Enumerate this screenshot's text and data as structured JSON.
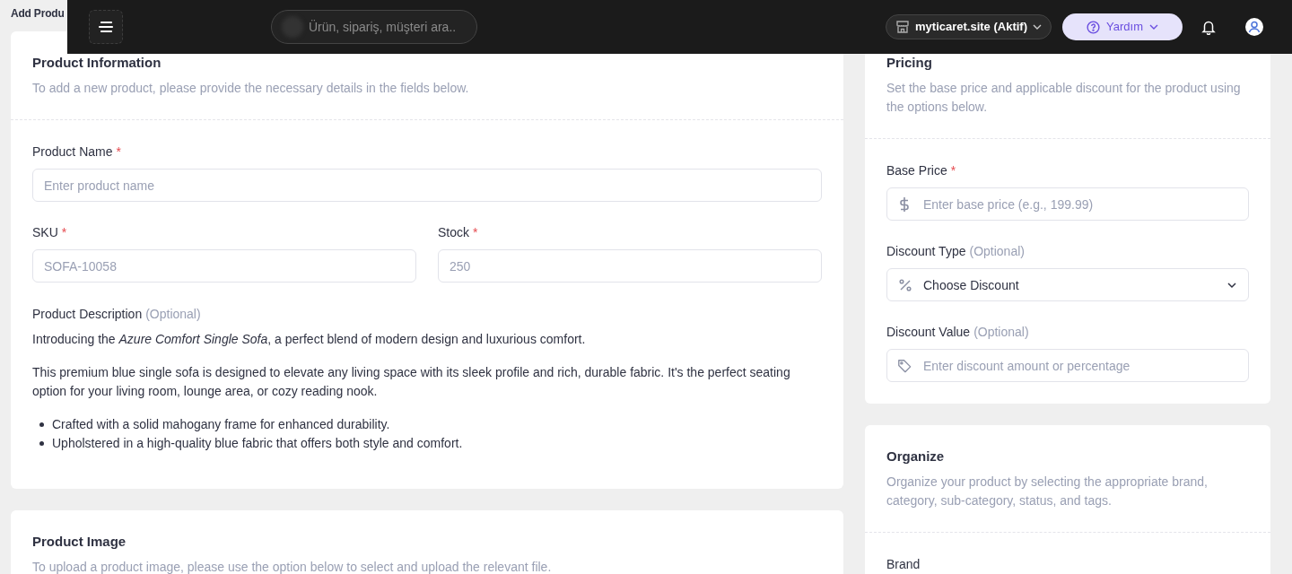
{
  "page_title": "Add Produ",
  "topbar": {
    "search": {
      "placeholder": "Ürün, sipariş, müşteri ara.."
    },
    "store": "myticaret.site (Aktif)",
    "help": "Yardım"
  },
  "product_information": {
    "title": "Product Information",
    "description": "To add a new product, please provide the necessary details in the fields below.",
    "fields": [
      {
        "label": "Product Name",
        "required_mark": "*",
        "placeholder": "Enter product name",
        "half": false
      },
      {
        "label": "SKU",
        "required_mark": "*",
        "placeholder": "SOFA-10058",
        "half": true
      },
      {
        "label": "Stock",
        "required_mark": "*",
        "placeholder": "250",
        "half": true
      }
    ],
    "product_description": {
      "label": "Product Description",
      "optional": "(Optional)",
      "paragraphs": [
        "Introducing the *Azure Comfort Single Sofa*, a perfect blend of modern design and luxurious comfort.",
        "This premium blue single sofa is designed to elevate any living space with its sleek profile and rich, durable fabric. It's the perfect seating option for your living room, lounge area, or cozy reading nook."
      ],
      "bullets": [
        "Crafted with a solid mahogany frame for enhanced durability.",
        "Upholstered in a high-quality blue fabric that offers both style and comfort."
      ]
    }
  },
  "product_image": {
    "title": "Product Image",
    "description": "To upload a product image, please use the option below to select and upload the relevant file."
  },
  "pricing": {
    "title": "Pricing",
    "description": "Set the base price and applicable discount for the product using the options below.",
    "fields": [
      {
        "kind": "price",
        "label": "Base Price",
        "required_mark": "*",
        "placeholder": "Enter base price (e.g., 199.99)"
      },
      {
        "kind": "select",
        "label": "Discount Type",
        "optional": "(Optional)",
        "value": "Choose Discount"
      },
      {
        "kind": "tag",
        "label": "Discount Value",
        "optional": "(Optional)",
        "placeholder": "Enter discount amount or percentage"
      }
    ]
  },
  "organize": {
    "title": "Organize",
    "description": "Organize your product by selecting the appropriate brand, category, sub-category, status, and tags.",
    "first_label": "Brand"
  }
}
